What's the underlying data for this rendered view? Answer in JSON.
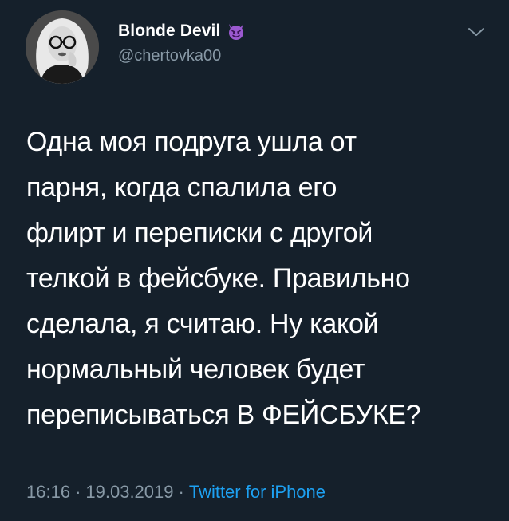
{
  "tweet": {
    "display_name": "Blonde Devil",
    "name_emoji": "smiling-face-with-horns-icon",
    "handle": "@chertovka00",
    "text_lines": [
      "Одна моя подруга ушла от",
      "парня, когда спалила его",
      "флирт и переписки с другой",
      "телкой в фейсбуке. Правильно",
      "сделала, я считаю. Ну какой",
      "нормальный человек будет",
      "переписываться В ФЕЙСБУКЕ?"
    ],
    "time": "16:16",
    "separator": "·",
    "date": "19.03.2019",
    "source": "Twitter for iPhone"
  },
  "colors": {
    "background": "#15202b",
    "text": "#ffffff",
    "secondary": "#8899a6",
    "link": "#1da1f2",
    "emoji": "#9b59d0"
  }
}
